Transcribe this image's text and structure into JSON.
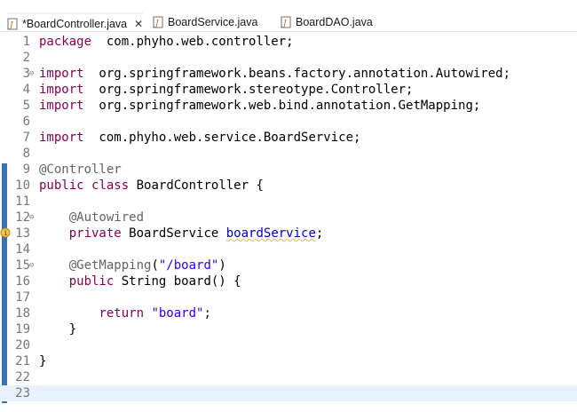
{
  "tabs": [
    {
      "label": "*BoardController.java",
      "close": "✕",
      "active": true
    },
    {
      "label": "BoardService.java",
      "active": false
    },
    {
      "label": "BoardDAO.java",
      "active": false
    }
  ],
  "lines": [
    {
      "n": "1",
      "tokens": [
        [
          "kw",
          "package"
        ],
        [
          "",
          "  com.phyho.web.controller;"
        ]
      ]
    },
    {
      "n": "2",
      "tokens": []
    },
    {
      "n": "3",
      "fold": "⊖",
      "tokens": [
        [
          "kw",
          "import"
        ],
        [
          "",
          "  org.springframework.beans.factory.annotation.Autowired;"
        ]
      ]
    },
    {
      "n": "4",
      "tokens": [
        [
          "kw",
          "import"
        ],
        [
          "",
          "  org.springframework.stereotype.Controller;"
        ]
      ]
    },
    {
      "n": "5",
      "tokens": [
        [
          "kw",
          "import"
        ],
        [
          "",
          "  org.springframework.web.bind.annotation.GetMapping;"
        ]
      ]
    },
    {
      "n": "6",
      "tokens": []
    },
    {
      "n": "7",
      "tokens": [
        [
          "kw",
          "import"
        ],
        [
          "",
          "  com.phyho.web.service.BoardService;"
        ]
      ]
    },
    {
      "n": "8",
      "tokens": []
    },
    {
      "n": "9",
      "tokens": [
        [
          "ann",
          "@Controller"
        ]
      ]
    },
    {
      "n": "10",
      "tokens": [
        [
          "kw",
          "public"
        ],
        [
          "",
          " "
        ],
        [
          "kw",
          "class"
        ],
        [
          "",
          " BoardController {"
        ]
      ]
    },
    {
      "n": "11",
      "tokens": []
    },
    {
      "n": "12",
      "fold": "⊖",
      "tokens": [
        [
          "",
          "    "
        ],
        [
          "ann",
          "@Autowired"
        ]
      ]
    },
    {
      "n": "13",
      "tokens": [
        [
          "",
          "    "
        ],
        [
          "kw",
          "private"
        ],
        [
          "",
          " BoardService "
        ],
        [
          "fld",
          "boardService"
        ],
        [
          "",
          ";"
        ]
      ]
    },
    {
      "n": "14",
      "tokens": []
    },
    {
      "n": "15",
      "fold": "⊖",
      "tokens": [
        [
          "",
          "    "
        ],
        [
          "ann",
          "@GetMapping"
        ],
        [
          "",
          "("
        ],
        [
          "str",
          "\"/board\""
        ],
        [
          "",
          ")"
        ]
      ]
    },
    {
      "n": "16",
      "tokens": [
        [
          "",
          "    "
        ],
        [
          "kw",
          "public"
        ],
        [
          "",
          " String board() {"
        ]
      ]
    },
    {
      "n": "17",
      "tokens": []
    },
    {
      "n": "18",
      "tokens": [
        [
          "",
          "        "
        ],
        [
          "kw",
          "return"
        ],
        [
          "",
          " "
        ],
        [
          "str",
          "\"board\""
        ],
        [
          "",
          ";"
        ]
      ]
    },
    {
      "n": "19",
      "tokens": [
        [
          "",
          "    }"
        ]
      ]
    },
    {
      "n": "20",
      "tokens": []
    },
    {
      "n": "21",
      "tokens": [
        [
          "",
          "}"
        ]
      ]
    },
    {
      "n": "22",
      "tokens": []
    },
    {
      "n": "23",
      "tokens": [],
      "current": true
    }
  ],
  "colors": {
    "keyword": "#7f0055",
    "annotation": "#646464",
    "string": "#2a00ff",
    "field": "#0000c0",
    "change_bar": "#3b6fb6",
    "current_line": "#e8f2fe"
  }
}
